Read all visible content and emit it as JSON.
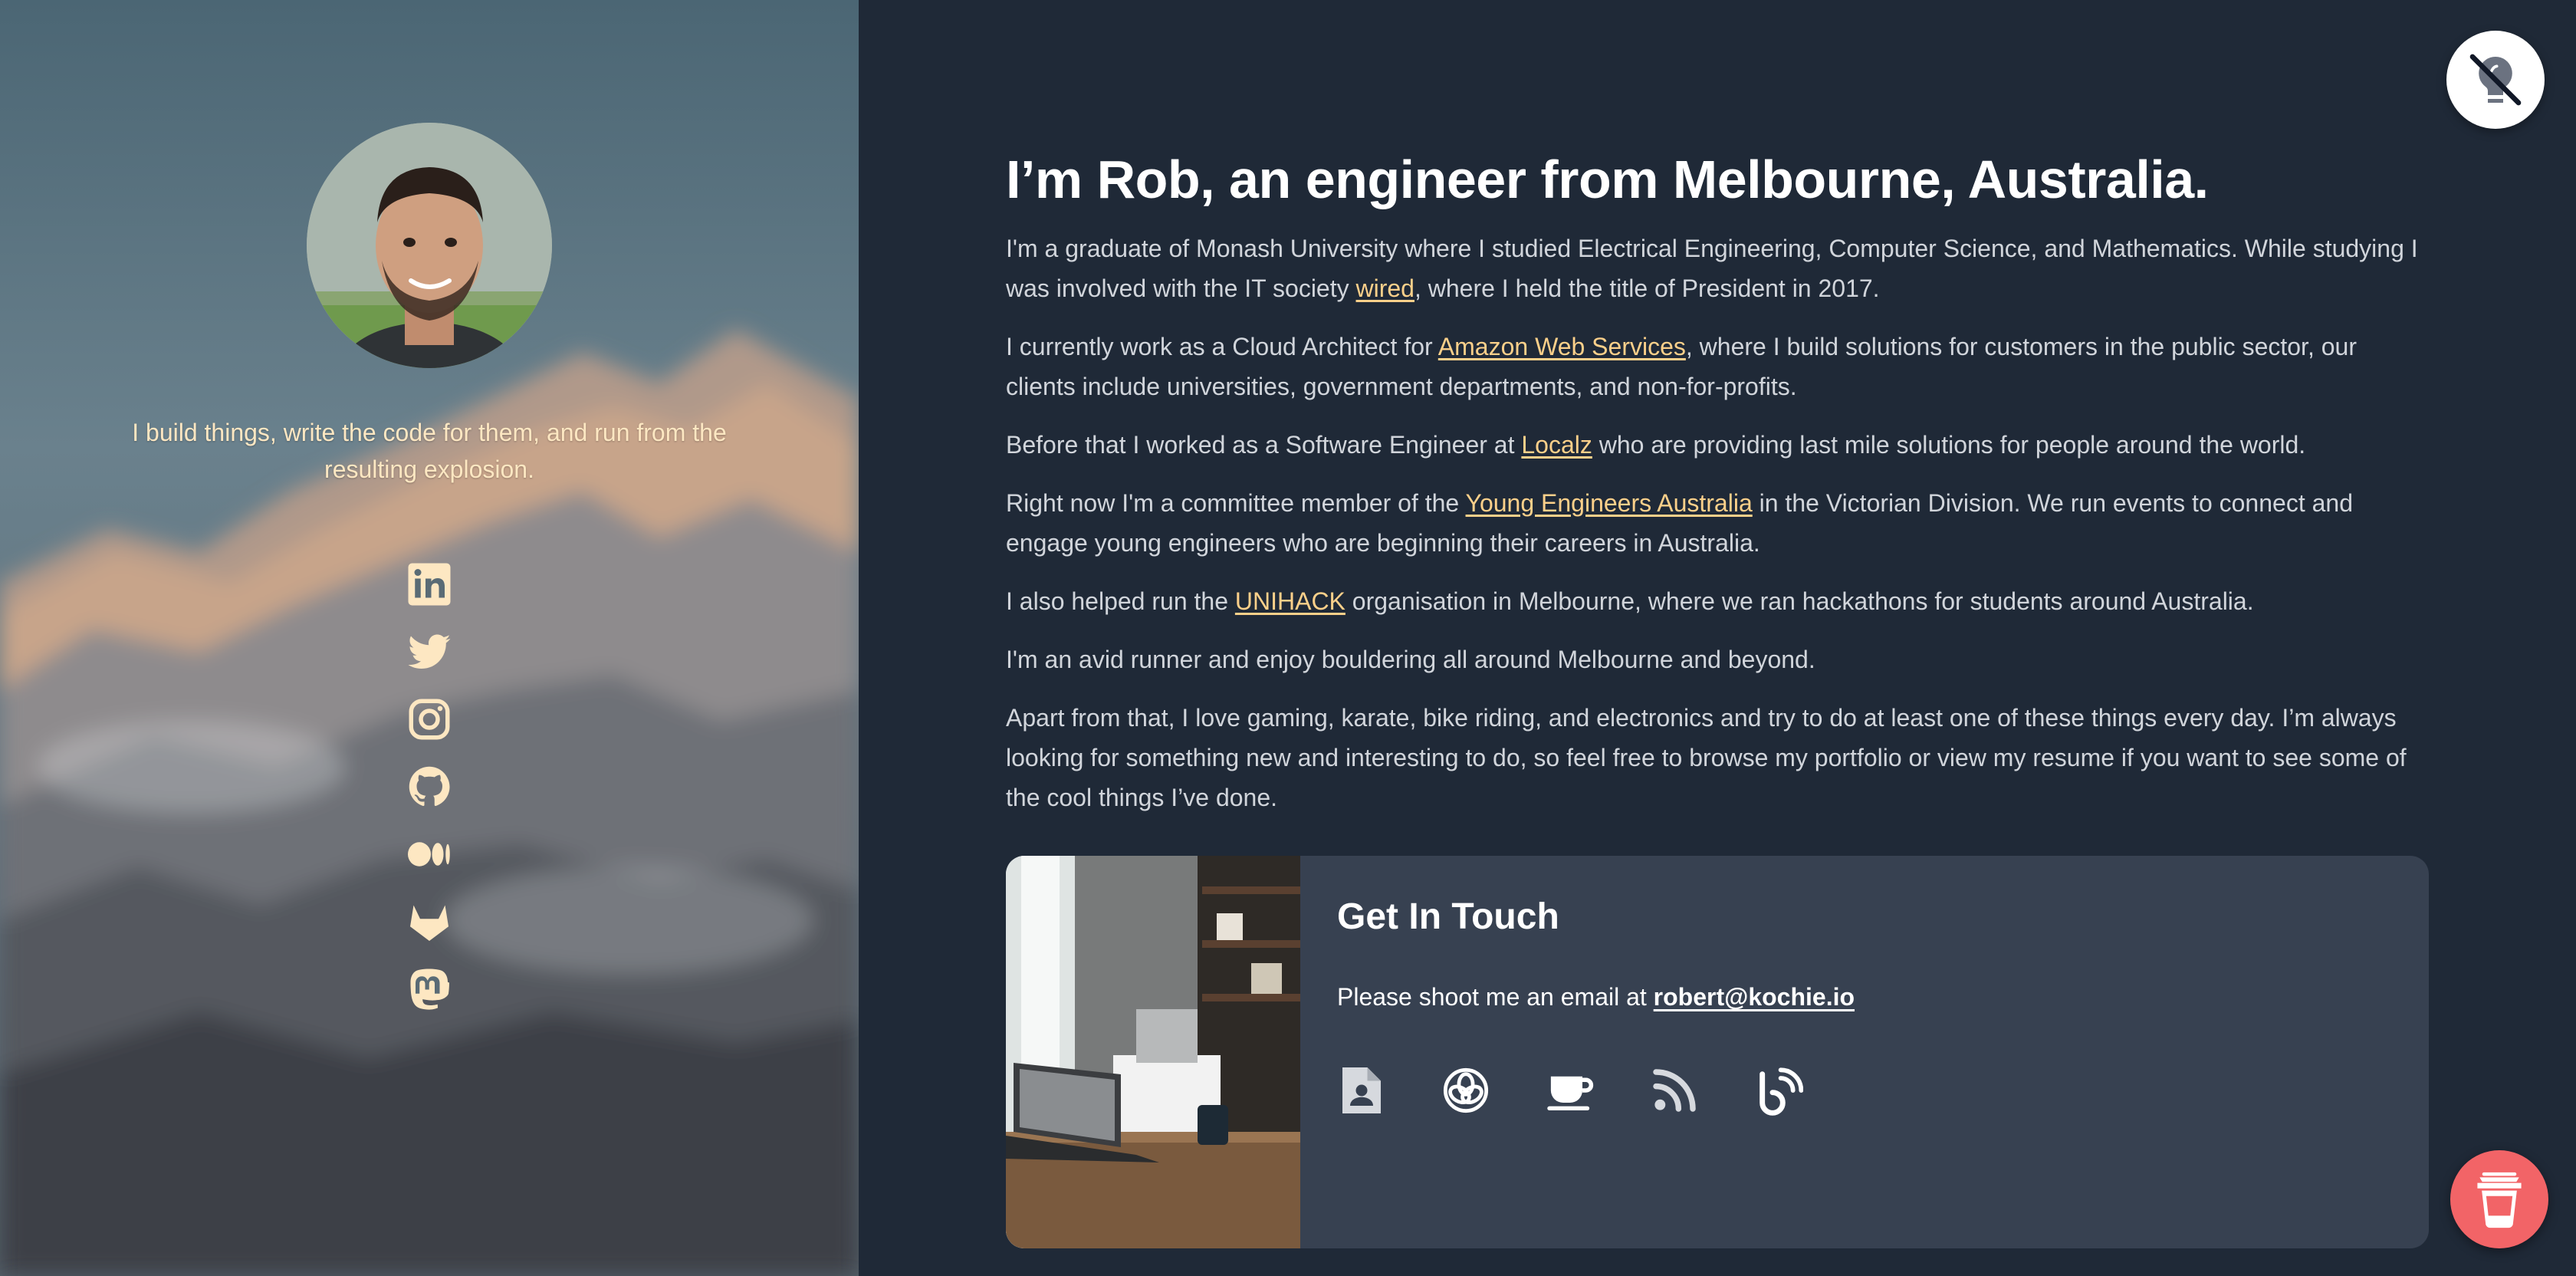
{
  "profile": {
    "tagline": "I build things, write the code for them, and run from the resulting explosion.",
    "avatar_alt": "Portrait of Rob"
  },
  "socials": [
    {
      "icon": "linkedin-icon"
    },
    {
      "icon": "twitter-icon"
    },
    {
      "icon": "instagram-icon"
    },
    {
      "icon": "github-icon"
    },
    {
      "icon": "medium-icon"
    },
    {
      "icon": "gitlab-icon"
    },
    {
      "icon": "mastodon-icon"
    }
  ],
  "main": {
    "heading": "I’m Rob, an engineer from Melbourne, Australia.",
    "p1": {
      "a": "I'm a graduate of Monash University where I studied Electrical Engineering, Computer Science, and Mathematics. While studying I was involved with the IT society ",
      "link": "wired",
      "b": ", where I held the title of President in 2017."
    },
    "p2": {
      "a": "I currently work as a Cloud Architect for ",
      "link": "Amazon Web Services",
      "b": ", where I build solutions for customers in the public sector, our clients include universities, government departments, and non-for-profits."
    },
    "p3": {
      "a": "Before that I worked as a Software Engineer at ",
      "link": "Localz",
      "b": " who are providing last mile solutions for people around the world."
    },
    "p4": {
      "a": "Right now I'm a committee member of the ",
      "link": "Young Engineers Australia",
      "b": " in the Victorian Division. We run events to connect and engage young engineers who are beginning their careers in Australia."
    },
    "p5": {
      "a": "I also helped run the ",
      "link": "UNIHACK",
      "b": " organisation in Melbourne, where we ran hackathons for students around Australia."
    },
    "p6": "I'm an avid runner and enjoy bouldering all around Melbourne and beyond.",
    "p7": "Apart from that, I love gaming, karate, bike riding, and electronics and try to do at least one of these things every day. I’m always looking for something new and interesting to do, so feel free to browse my portfolio or view my resume if you want to see some of the cool things I’ve done."
  },
  "contact": {
    "title": "Get In Touch",
    "email_prefix": "Please shoot me an email at ",
    "email": "robert@kochie.io",
    "links": [
      {
        "icon": "resume-icon"
      },
      {
        "icon": "openai-icon"
      },
      {
        "icon": "coffee-cup-icon"
      },
      {
        "icon": "rss-icon"
      },
      {
        "icon": "blog-icon"
      }
    ]
  },
  "colors": {
    "background": "#1f2937",
    "card": "#374151",
    "accent_link": "#fcd08a",
    "tagline": "#fde7c2",
    "coffee_button": "#f26467"
  }
}
